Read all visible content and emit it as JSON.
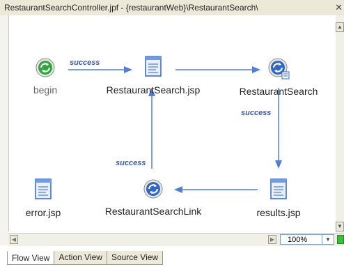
{
  "window": {
    "title": "RestaurantSearchController.jpf - {restaurantWeb}\\RestaurantSearch\\",
    "close_glyph": "✕"
  },
  "nodes": {
    "begin": {
      "label": "begin",
      "icon": "begin-action-icon"
    },
    "restaurant_search_jsp": {
      "label": "RestaurantSearch.jsp",
      "icon": "jsp-page-icon"
    },
    "restaurant_search": {
      "label": "RestaurantSearch",
      "icon": "action-icon"
    },
    "error_jsp": {
      "label": "error.jsp",
      "icon": "jsp-page-icon"
    },
    "restaurant_search_link": {
      "label": "RestaurantSearchLink",
      "icon": "action-icon"
    },
    "results_jsp": {
      "label": "results.jsp",
      "icon": "jsp-page-icon"
    }
  },
  "edges": {
    "begin_to_jsp": "success",
    "search_to_results": "success",
    "link_to_jsp": "success"
  },
  "zoom": {
    "value": "100%"
  },
  "tabs": [
    {
      "label": "Flow View",
      "active": true
    },
    {
      "label": "Action View",
      "active": false
    },
    {
      "label": "Source View",
      "active": false
    }
  ],
  "colors": {
    "edge": "#4f7fd8",
    "edge_label": "#3d5ab8",
    "green": "#35c335"
  }
}
